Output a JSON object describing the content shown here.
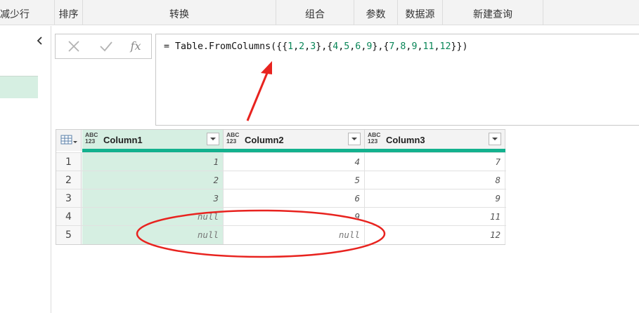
{
  "ribbon": {
    "groups": [
      {
        "id": "reduce_rows",
        "label": "减少行"
      },
      {
        "id": "sort",
        "label": "排序"
      },
      {
        "id": "transform",
        "label": "转换"
      },
      {
        "id": "combine",
        "label": "组合"
      },
      {
        "id": "parameters",
        "label": "参数"
      },
      {
        "id": "data_sources",
        "label": "数据源"
      },
      {
        "id": "new_query",
        "label": "新建查询"
      }
    ]
  },
  "formula_bar": {
    "cancel_icon": "x-icon",
    "commit_icon": "check-icon",
    "fx_label": "fx",
    "formula": "= Table.FromColumns({{1,2,3},{4,5,6,9},{7,8,9,11,12}})"
  },
  "table": {
    "columns": [
      {
        "type_top": "ABC",
        "type_bottom": "123",
        "name": "Column1",
        "selected": true
      },
      {
        "type_top": "ABC",
        "type_bottom": "123",
        "name": "Column2",
        "selected": false
      },
      {
        "type_top": "ABC",
        "type_bottom": "123",
        "name": "Column3",
        "selected": false
      }
    ],
    "rows": [
      {
        "n": "1",
        "cells": [
          "1",
          "4",
          "7"
        ]
      },
      {
        "n": "2",
        "cells": [
          "2",
          "5",
          "8"
        ]
      },
      {
        "n": "3",
        "cells": [
          "3",
          "6",
          "9"
        ]
      },
      {
        "n": "4",
        "cells": [
          "null",
          "9",
          "11"
        ]
      },
      {
        "n": "5",
        "cells": [
          "null",
          "null",
          "12"
        ]
      }
    ]
  },
  "colors": {
    "selected_column": "#d6efe2",
    "quality_bar": "#13b18e",
    "annotation": "#e8231f"
  }
}
